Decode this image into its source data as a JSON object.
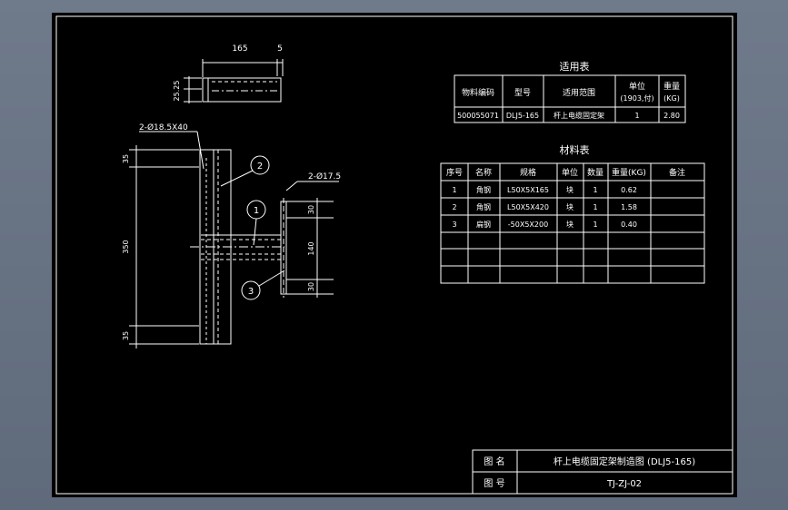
{
  "drawing": {
    "top_view_dims": {
      "length": "165",
      "offset": "5",
      "height": "25.25"
    },
    "hole_note_1": "2-Ø18.5X40",
    "hole_note_2": "2-Ø17.5",
    "side_dims": {
      "top": "35",
      "total": "350",
      "bottom": "35"
    },
    "plate_dims": {
      "top": "30",
      "mid": "140",
      "bottom": "30"
    },
    "balloons": [
      "2",
      "1",
      "3"
    ]
  },
  "usage_table": {
    "title": "适用表",
    "headers": [
      "物料编码",
      "型号",
      "适用范围",
      "单位",
      "重量"
    ],
    "header_sub": {
      "unit": "(1903,付)",
      "weight": "(KG)"
    },
    "rows": [
      [
        "500055071",
        "DLJ5-165",
        "杆上电缆固定架",
        "1",
        "2.80"
      ]
    ]
  },
  "material_table": {
    "title": "材料表",
    "headers": [
      "序号",
      "名称",
      "规格",
      "单位",
      "数量",
      "重量(KG)",
      "备注"
    ],
    "rows": [
      [
        "1",
        "角钢",
        "L50X5X165",
        "块",
        "1",
        "0.62",
        ""
      ],
      [
        "2",
        "角钢",
        "L50X5X420",
        "块",
        "1",
        "1.58",
        ""
      ],
      [
        "3",
        "扁钢",
        "-50X5X200",
        "块",
        "1",
        "0.40",
        ""
      ],
      [
        "",
        "",
        "",
        "",
        "",
        "",
        ""
      ],
      [
        "",
        "",
        "",
        "",
        "",
        "",
        ""
      ],
      [
        "",
        "",
        "",
        "",
        "",
        "",
        ""
      ]
    ]
  },
  "title_block": {
    "name_label": "图  名",
    "name_value": "杆上电缆固定架制造图 (DLJ5-165)",
    "number_label": "图  号",
    "number_value": "TJ-ZJ-02"
  }
}
